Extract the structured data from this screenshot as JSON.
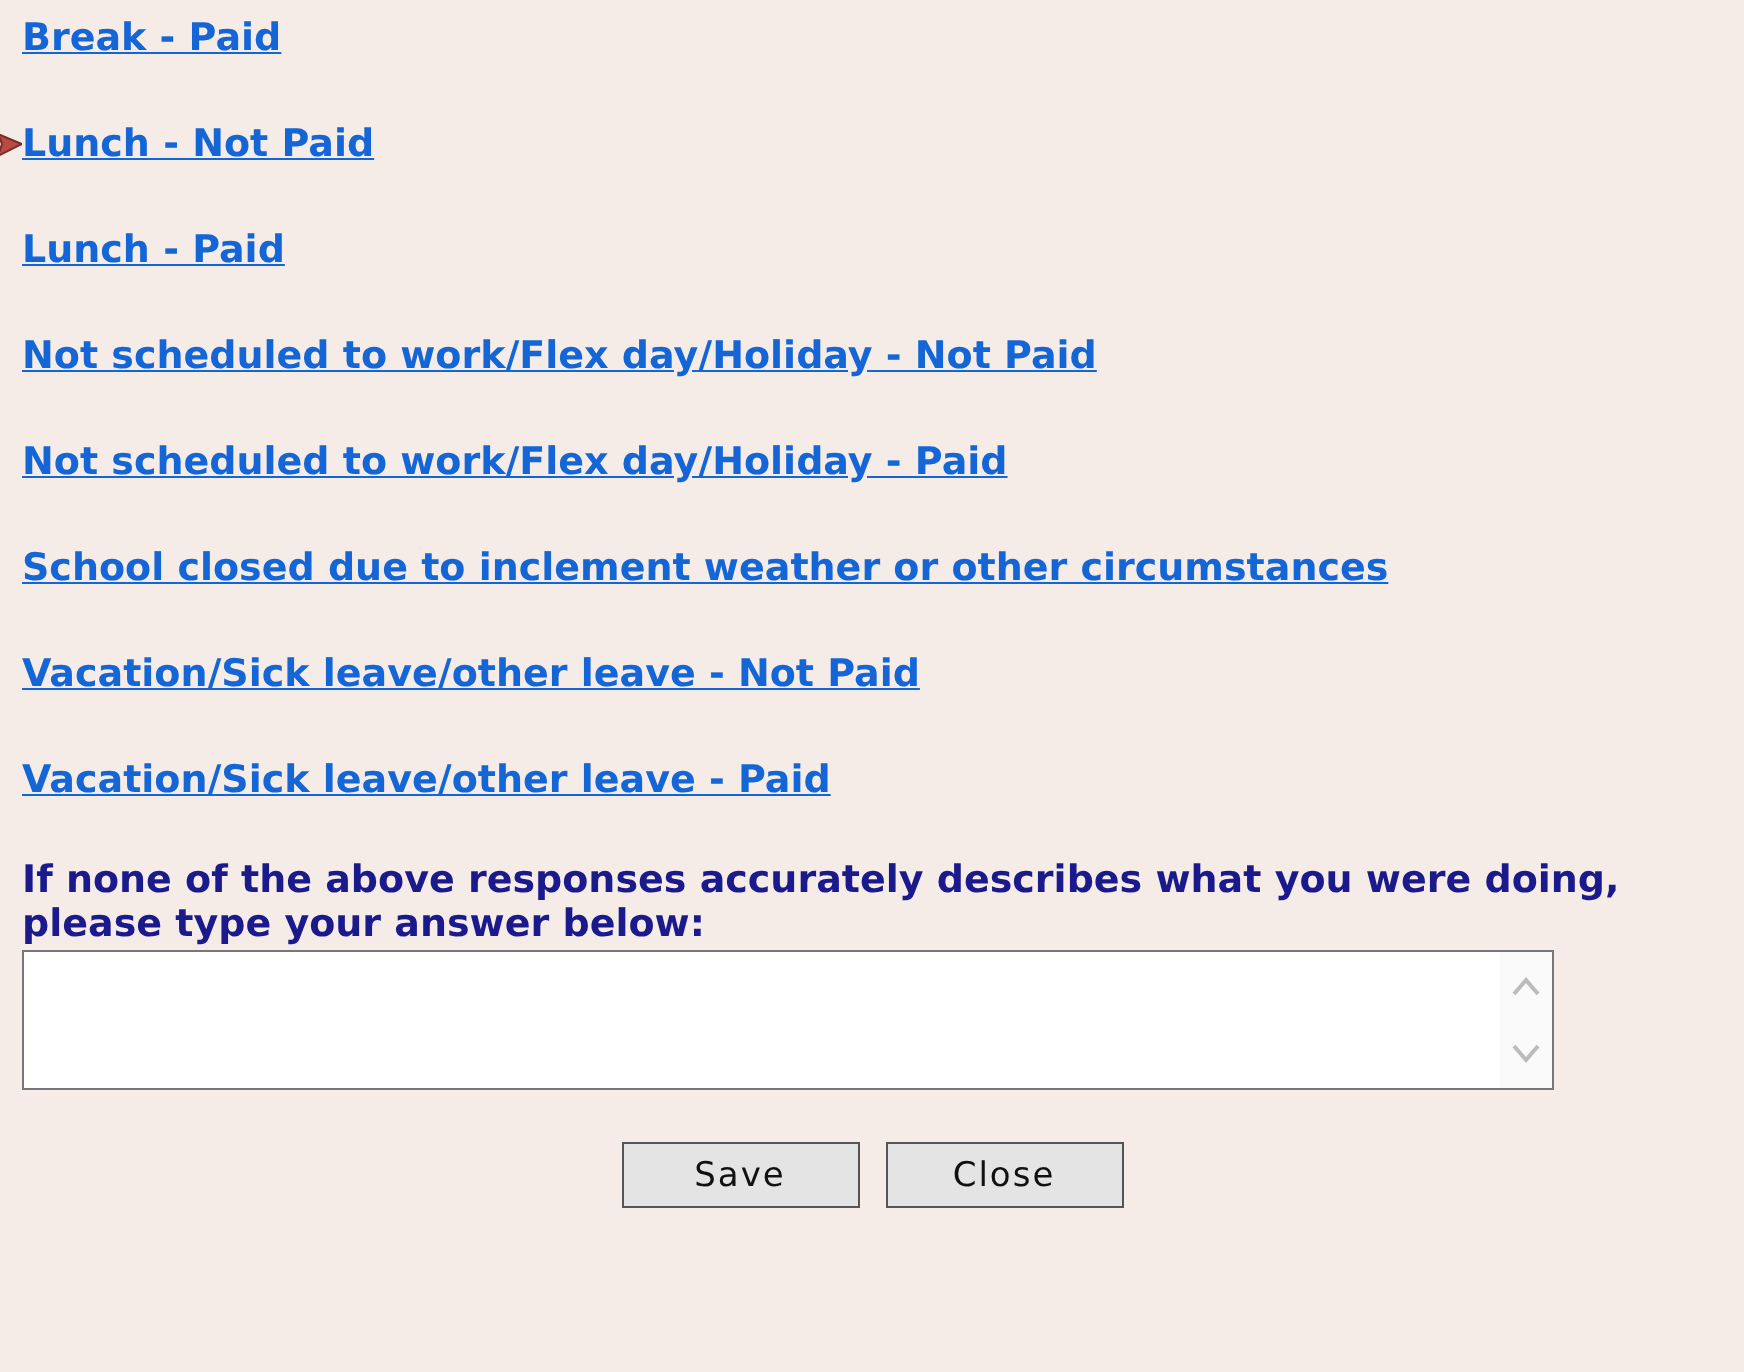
{
  "links": [
    {
      "label": "Break - Paid",
      "selected": false
    },
    {
      "label": "Lunch - Not Paid",
      "selected": true
    },
    {
      "label": "Lunch - Paid",
      "selected": false
    },
    {
      "label": "Not scheduled to work/Flex day/Holiday - Not Paid",
      "selected": false
    },
    {
      "label": "Not scheduled to work/Flex day/Holiday - Paid",
      "selected": false
    },
    {
      "label": "School closed due to inclement weather or other circumstances",
      "selected": false
    },
    {
      "label": "Vacation/Sick leave/other leave - Not Paid",
      "selected": false
    },
    {
      "label": "Vacation/Sick leave/other leave - Paid",
      "selected": false
    }
  ],
  "prompt": "If none of the above responses accurately describes what you were doing, please type your answer below:",
  "buttons": [
    "Save",
    "Close"
  ]
}
